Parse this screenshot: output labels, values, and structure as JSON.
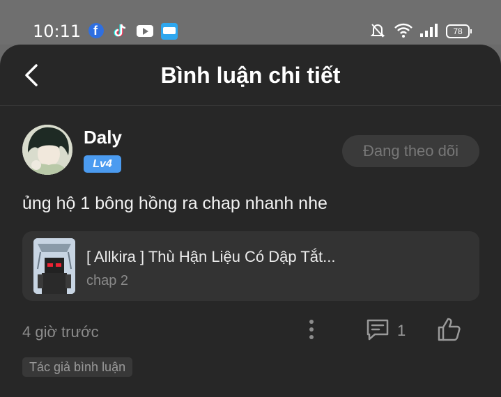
{
  "status_bar": {
    "time": "10:11",
    "battery": "78",
    "app_icons": [
      "facebook-icon",
      "tiktok-icon",
      "youtube-icon",
      "webtoon-icon"
    ],
    "system_icons": [
      "bell-off-icon",
      "wifi-icon",
      "signal-icon",
      "battery-icon"
    ]
  },
  "header": {
    "title": "Bình luận chi tiết",
    "back_icon": "chevron-left-icon"
  },
  "comment": {
    "username": "Daly",
    "level": "Lv4",
    "follow_label": "Đang theo dõi",
    "text": "ủng hộ 1 bông hồng ra chap nhanh nhe",
    "work": {
      "title": "[ Allkira ] Thù Hận Liệu Có Dập Tắt...",
      "chapter": "chap 2"
    },
    "time_ago": "4 giờ trước",
    "reply_count": "1",
    "author_tag": "Tác giả bình luận"
  },
  "colors": {
    "background": "#272727",
    "level_badge": "#4b9bf0",
    "card": "#333333"
  }
}
